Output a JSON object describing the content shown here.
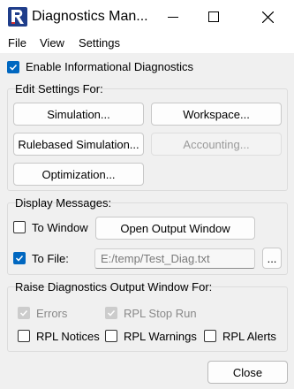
{
  "window": {
    "title": "Diagnostics Man...",
    "minimize_icon": "minimize-icon",
    "maximize_icon": "maximize-icon",
    "close_icon": "close-icon",
    "accent": "#0067c0"
  },
  "menu": {
    "items": [
      "File",
      "View",
      "Settings"
    ]
  },
  "enable_info": {
    "label": "Enable Informational Diagnostics",
    "checked": true
  },
  "edit_settings": {
    "title": "Edit Settings For:",
    "simulation": "Simulation...",
    "workspace": "Workspace...",
    "rulebased": "Rulebased Simulation...",
    "accounting": "Accounting...",
    "optimization": "Optimization..."
  },
  "display_messages": {
    "title": "Display Messages:",
    "to_window": {
      "label": "To Window",
      "checked": false
    },
    "open_output": "Open Output Window",
    "to_file": {
      "label": "To File:",
      "checked": true
    },
    "file_path": "E:/temp/Test_Diag.txt",
    "browse": "..."
  },
  "raise_window": {
    "title": "Raise Diagnostics Output Window For:",
    "errors": {
      "label": "Errors",
      "checked": true,
      "disabled": true
    },
    "rpl_stop_run": {
      "label": "RPL Stop Run",
      "checked": true,
      "disabled": true
    },
    "rpl_notices": {
      "label": "RPL Notices",
      "checked": false
    },
    "rpl_warnings": {
      "label": "RPL Warnings",
      "checked": false
    },
    "rpl_alerts": {
      "label": "RPL Alerts",
      "checked": false
    }
  },
  "close_button": "Close"
}
